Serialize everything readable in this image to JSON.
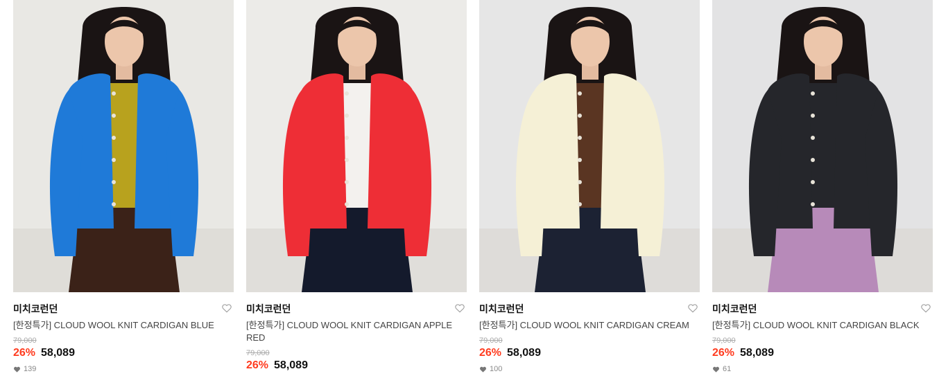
{
  "products": [
    {
      "brand": "미치코런던",
      "name": "[한정특가] CLOUD WOOL KNIT CARDIGAN BLUE",
      "original_price": "79,000",
      "discount": "26%",
      "price": "58,089",
      "likes": "139",
      "cardigan_color": "#1f7ad8",
      "inner_color": "#b8a21e",
      "bottom_color": "#3b2218",
      "bg_color": "#e9e8e4",
      "heart_icon": "heart-outline-icon"
    },
    {
      "brand": "미치코런던",
      "name": "[한정특가] CLOUD WOOL KNIT CARDIGAN APPLE RED",
      "original_price": "79,000",
      "discount": "26%",
      "price": "58,089",
      "likes": "",
      "cardigan_color": "#ee2e36",
      "inner_color": "#f3f1ee",
      "bottom_color": "#141a2c",
      "bg_color": "#ecebe8",
      "heart_icon": "heart-outline-icon"
    },
    {
      "brand": "미치코런던",
      "name": "[한정특가] CLOUD WOOL KNIT CARDIGAN CREAM",
      "original_price": "79,000",
      "discount": "26%",
      "price": "58,089",
      "likes": "100",
      "cardigan_color": "#f5f0d6",
      "inner_color": "#5a3522",
      "bottom_color": "#1c2233",
      "bg_color": "#e6e6e6",
      "heart_icon": "heart-outline-icon"
    },
    {
      "brand": "미치코런던",
      "name": "[한정특가] CLOUD WOOL KNIT CARDIGAN BLACK",
      "original_price": "79,000",
      "discount": "26%",
      "price": "58,089",
      "likes": "61",
      "cardigan_color": "#25262b",
      "inner_color": "#25262b",
      "bottom_color": "#b78ab9",
      "bg_color": "#e3e3e4",
      "heart_icon": "heart-outline-icon"
    }
  ]
}
